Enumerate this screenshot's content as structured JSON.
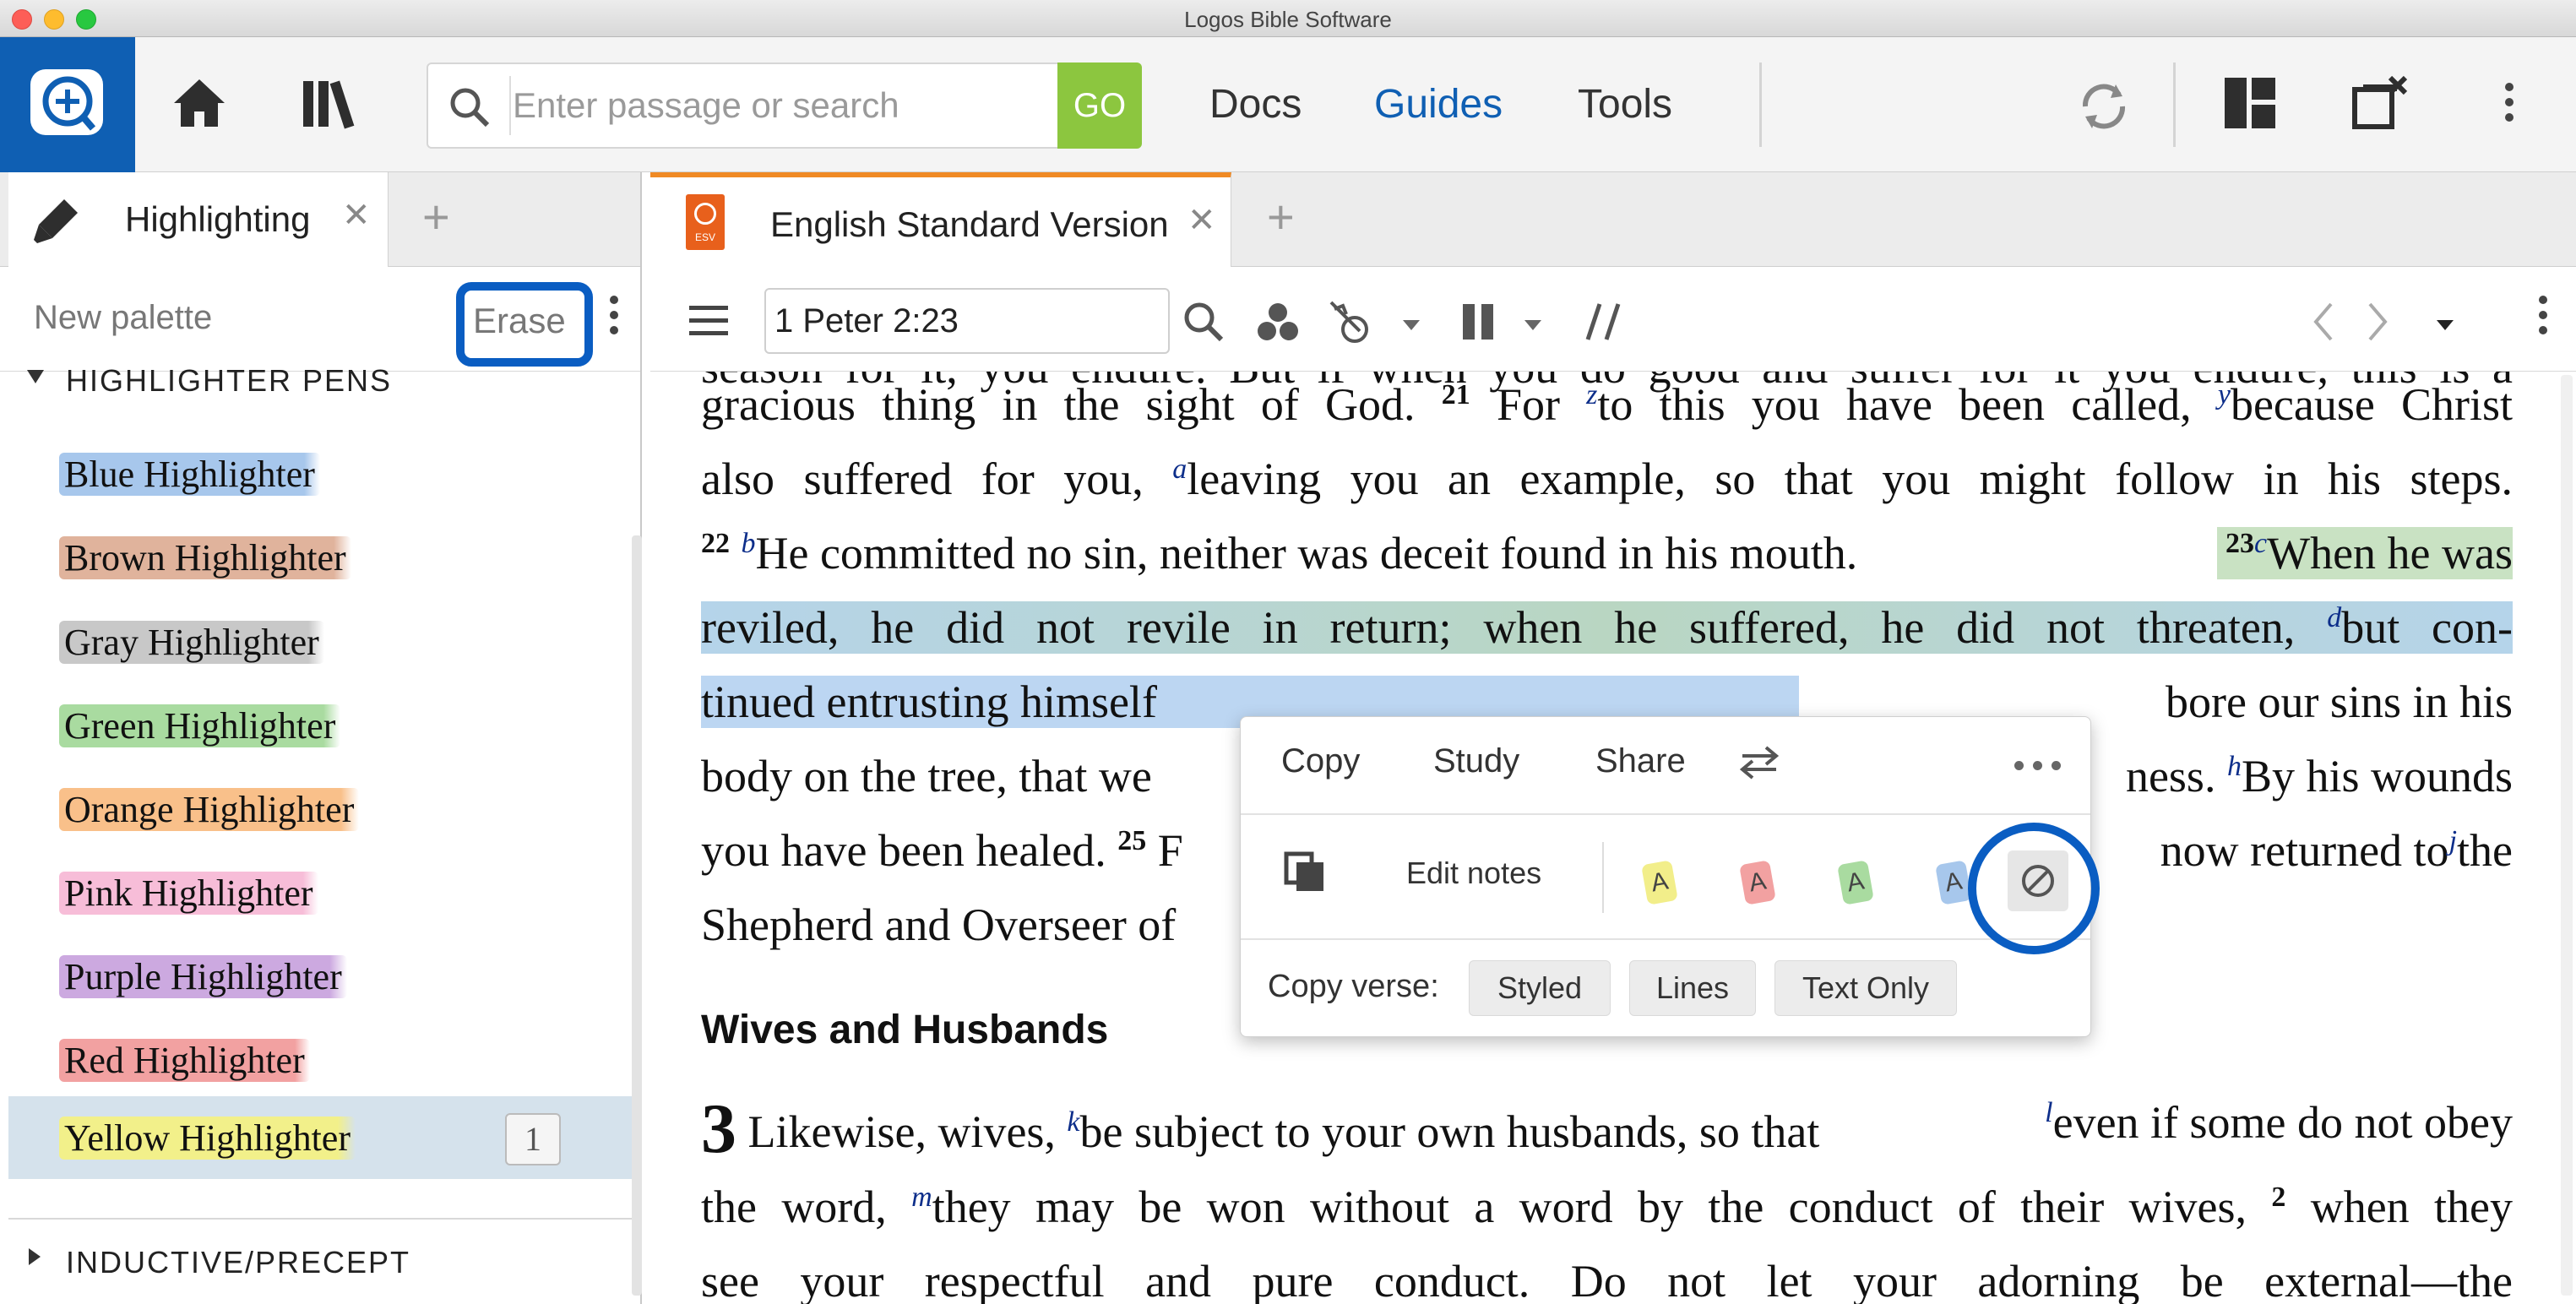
{
  "window": {
    "title": "Logos Bible Software"
  },
  "toolbar": {
    "search_placeholder": "Enter passage or search",
    "go_label": "GO",
    "nav": [
      "Docs",
      "Guides",
      "Tools"
    ],
    "active_nav": "Guides",
    "accent_color": "#0f5fb3"
  },
  "left_panel": {
    "tab_label": "Highlighting",
    "palette_label": "New palette",
    "erase_label": "Erase",
    "section_pens": "HIGHLIGHTER PENS",
    "section_inductive": "INDUCTIVE/PRECEPT",
    "pens": [
      {
        "name": "Blue Highlighter",
        "color": "#a7c7ec"
      },
      {
        "name": "Brown Highlighter",
        "color": "#e0b39c"
      },
      {
        "name": "Gray Highlighter",
        "color": "#c8c8c8"
      },
      {
        "name": "Green Highlighter",
        "color": "#a9dba0"
      },
      {
        "name": "Orange Highlighter",
        "color": "#f9c08a"
      },
      {
        "name": "Pink Highlighter",
        "color": "#f7bdd8"
      },
      {
        "name": "Purple Highlighter",
        "color": "#cca9e0"
      },
      {
        "name": "Red Highlighter",
        "color": "#f2a1a1"
      },
      {
        "name": "Yellow Highlighter",
        "color": "#f2f08a"
      }
    ],
    "yellow_count": "1"
  },
  "right_panel": {
    "tab_label": "English Standard Version",
    "tab_badge": "ESV",
    "reference": "1 Peter 2:23",
    "heading": "Wives and Husbands",
    "text": {
      "l0": "season for it, you endure. But if when you do good and suffer for it you endure, this is a",
      "l1a": "gracious thing in the sight of God.",
      "v21": "21",
      "l1b": "For",
      "fz": "z",
      "l1c": "to this you have been called,",
      "fy": "y",
      "l1d": "because Christ",
      "l2a": "also suffered for you,",
      "fa": "a",
      "l2b": "leaving you an example, so that you might follow in his steps.",
      "v22": "22",
      "fb": "b",
      "l3a": "He committed no sin, neither was deceit found in his mouth.",
      "v23": "23",
      "fc": "c",
      "l3b": "When he was",
      "l4a": "reviled, he did not revile in return; when he suffered, he did not threaten,",
      "fd": "d",
      "l4b": "but con-",
      "l5a": "tinued entrusting himself",
      "l5b": "bore our sins in his",
      "l6a": "body on the tree, that we",
      "l6b": "ness.",
      "fh": "h",
      "l6c": "By his wounds",
      "l7a": "you have been healed.",
      "v25": "25",
      "l7b": "F",
      "l7c": "now returned to",
      "fj": "j",
      "l7d": "the",
      "l8a": "Shepherd and Overseer of",
      "ch3": "3",
      "l9a": "Likewise, wives,",
      "fk": "k",
      "l9b": "be subject to your own husbands, so that",
      "fl": "l",
      "l9c": "even if some do not obey",
      "l10a": "the word,",
      "fm": "m",
      "l10b": "they may be won without a word by the conduct of their wives,",
      "v2": "2",
      "l10c": "when they",
      "l11": "see your respectful and pure conduct. Do not let your adorning be external—the"
    }
  },
  "popup": {
    "actions": [
      "Copy",
      "Study",
      "Share"
    ],
    "edit_notes": "Edit notes",
    "chip_letter": "A",
    "chip_colors": [
      "#f2ee8a",
      "#f2a1a1",
      "#a9dba0",
      "#a7c7ec"
    ],
    "copy_verse_label": "Copy verse:",
    "copy_buttons": [
      "Styled",
      "Lines",
      "Text Only"
    ]
  }
}
